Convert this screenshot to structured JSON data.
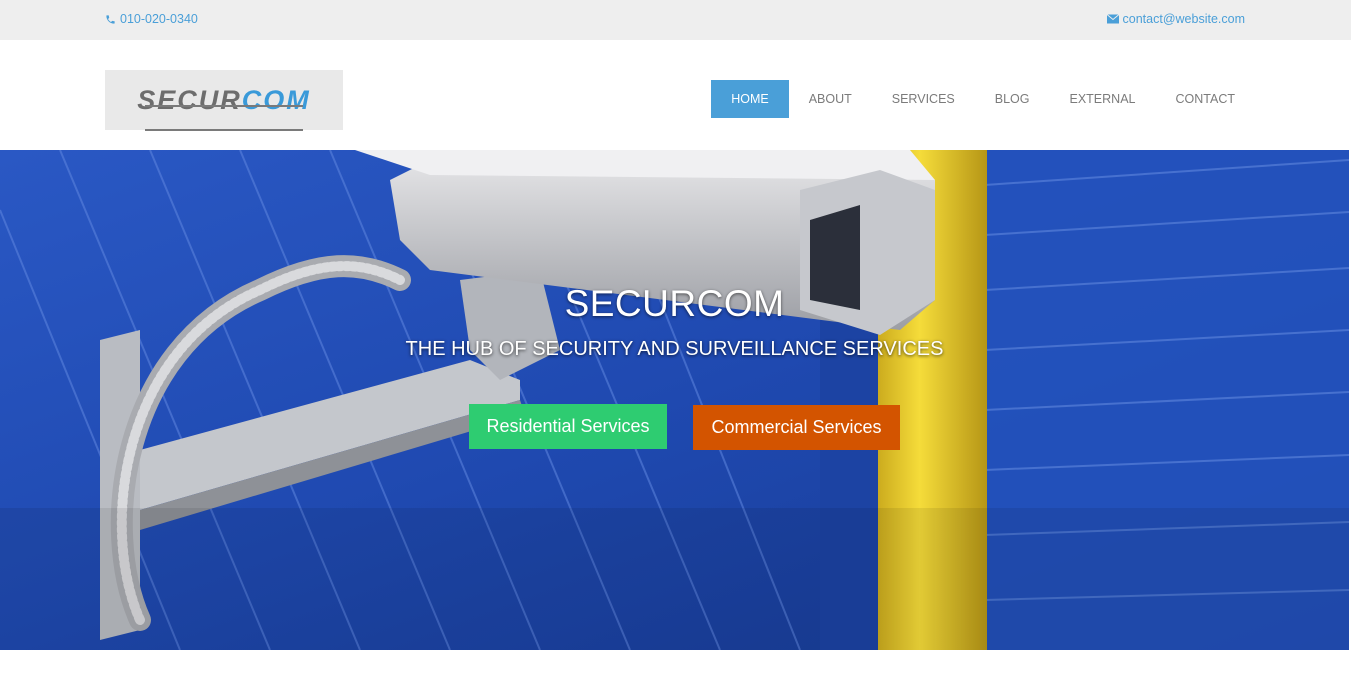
{
  "topbar": {
    "phone": "010-020-0340",
    "email": "contact@website.com",
    "icons": {
      "phone": "phone-icon",
      "email": "envelope-icon"
    }
  },
  "logo": {
    "text_main": "SECUR",
    "text_accent": "COM"
  },
  "nav": {
    "items": [
      {
        "label": "HOME",
        "active": true
      },
      {
        "label": "ABOUT",
        "active": false
      },
      {
        "label": "SERVICES",
        "active": false
      },
      {
        "label": "BLOG",
        "active": false
      },
      {
        "label": "EXTERNAL",
        "active": false
      },
      {
        "label": "CONTACT",
        "active": false
      }
    ]
  },
  "hero": {
    "title": "SECURCOM",
    "subtitle": "THE HUB OF SECURITY AND SURVEILLANCE SERVICES",
    "buttons": {
      "residential": "Residential Services",
      "commercial": "Commercial Services"
    }
  },
  "colors": {
    "accent": "#4a9fd8",
    "residential": "#2ecc71",
    "commercial": "#d35400",
    "hero_wall": "#1f49b0",
    "yellow_post": "#f2d22e"
  }
}
